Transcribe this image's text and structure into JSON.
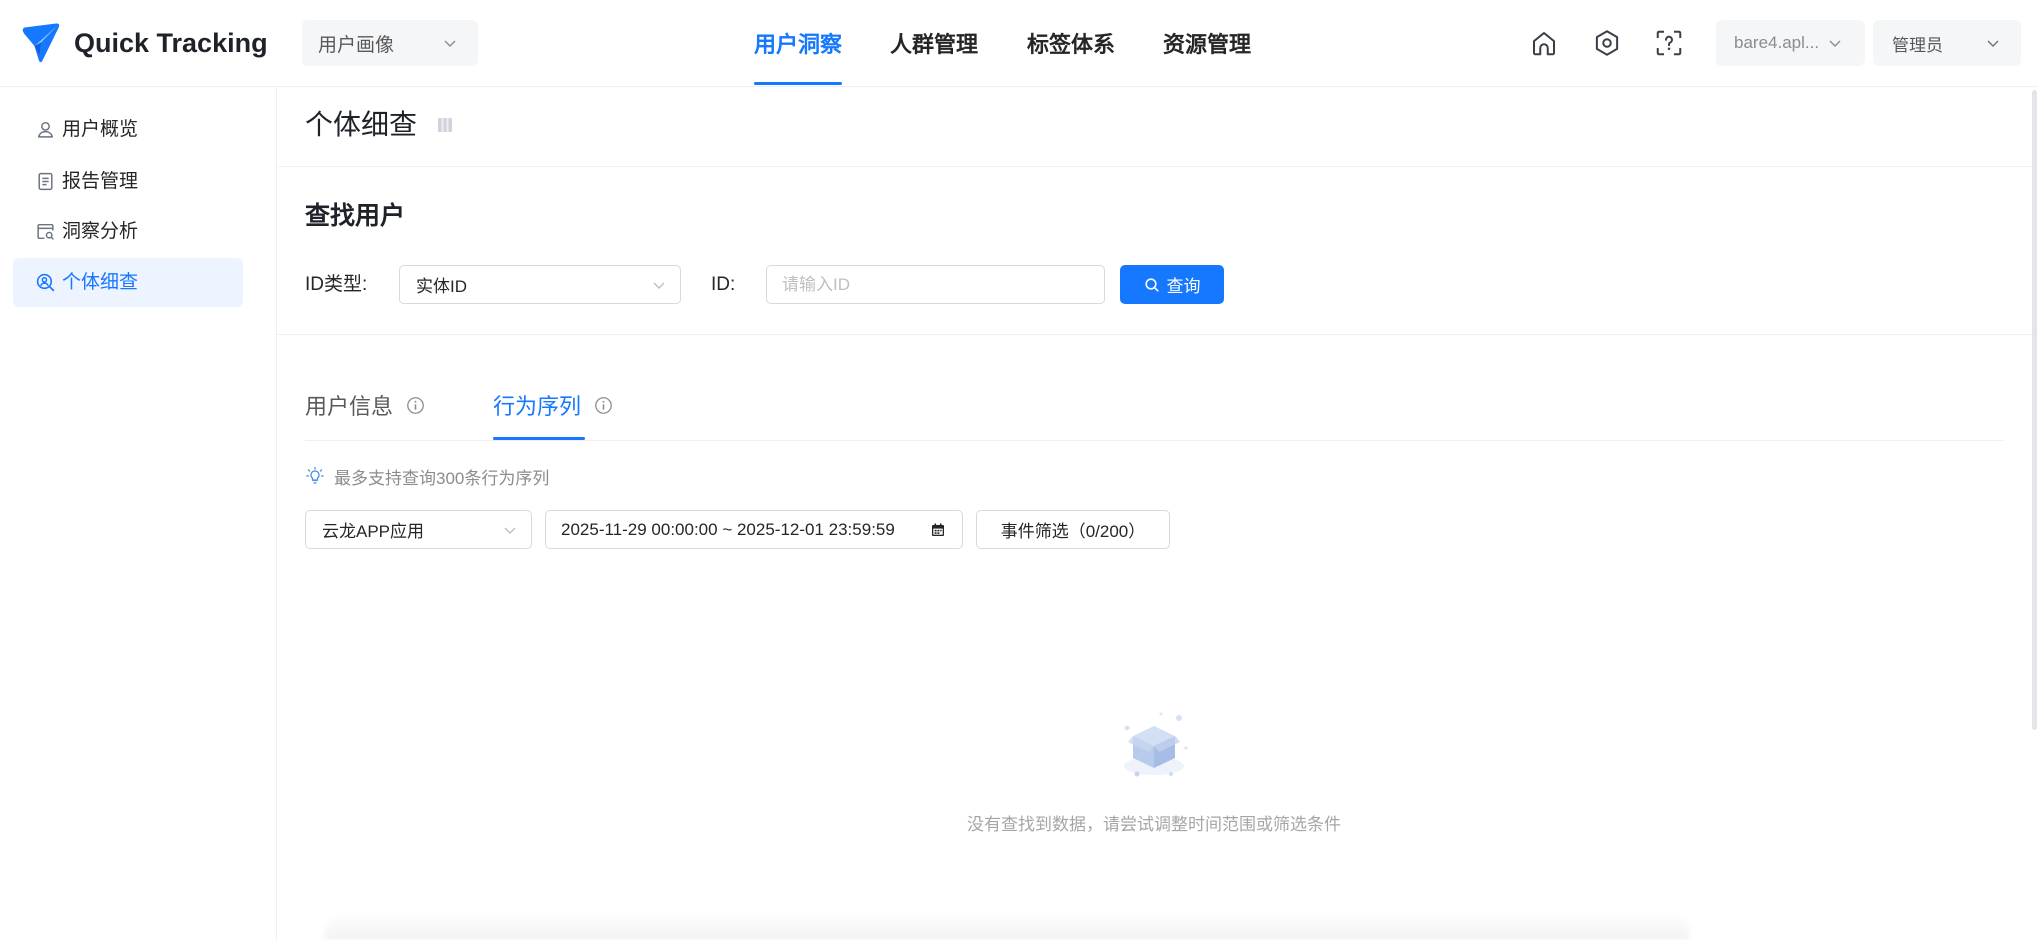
{
  "header": {
    "logo_text": "Quick Tracking",
    "logo_icon": "quick-tracking-logo-icon",
    "product_select": "用户画像",
    "nav": [
      {
        "label": "用户洞察",
        "active": true
      },
      {
        "label": "人群管理",
        "active": false
      },
      {
        "label": "标签体系",
        "active": false
      },
      {
        "label": "资源管理",
        "active": false
      }
    ],
    "icons": [
      "home-icon",
      "gear-icon",
      "help-scan-icon"
    ],
    "org_select": "bare4.apl...",
    "user_select": "管理员"
  },
  "sidebar": {
    "items": [
      {
        "label": "用户概览",
        "icon": "user-overview-icon",
        "active": false
      },
      {
        "label": "报告管理",
        "icon": "report-icon",
        "active": false
      },
      {
        "label": "洞察分析",
        "icon": "insight-analysis-icon",
        "active": false
      },
      {
        "label": "个体细查",
        "icon": "user-lookup-icon",
        "active": true
      }
    ]
  },
  "page": {
    "title": "个体细查",
    "title_icon": "bookmark-icon"
  },
  "search": {
    "title": "查找用户",
    "id_type_label": "ID类型:",
    "id_type_value": "实体ID",
    "id_label": "ID:",
    "id_value": "",
    "id_placeholder": "请输入ID",
    "query_button": "查询",
    "query_icon": "search-icon"
  },
  "tabs": [
    {
      "label": "用户信息",
      "active": false,
      "icon": "info-icon"
    },
    {
      "label": "行为序列",
      "active": true,
      "icon": "info-icon"
    }
  ],
  "behavior": {
    "tip_icon": "lightbulb-icon",
    "tip": "最多支持查询300条行为序列",
    "app_select": "云龙APP应用",
    "date_range": "2025-11-29 00:00:00 ~ 2025-12-01 23:59:59",
    "date_icon": "calendar-icon",
    "event_filter": "事件筛选（0/200）"
  },
  "empty_state": {
    "icon": "empty-box-icon",
    "text": "没有查找到数据，请尝试调整时间范围或筛选条件"
  },
  "colors": {
    "primary": "#1677ff",
    "active_bg": "#edf4ff",
    "text": "#1f2329",
    "muted": "#8c8c8c",
    "border": "#d9d9d9",
    "pill_bg": "#f5f6f8"
  }
}
